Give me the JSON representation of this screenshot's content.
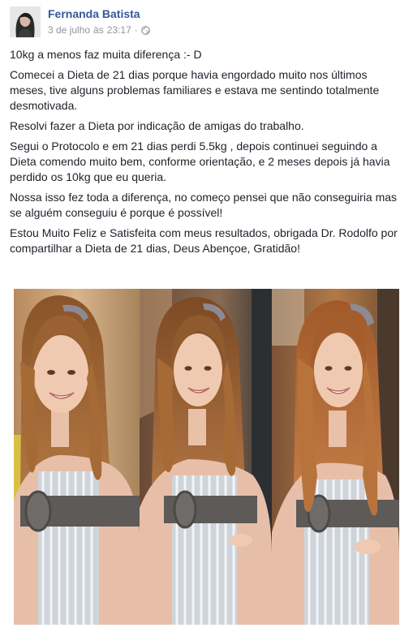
{
  "post": {
    "author": "Fernanda Batista",
    "date": "3 de julho",
    "time_prefix": "às",
    "time": "23:17",
    "separator": "·",
    "privacy_icon": "globe-icon",
    "paragraphs": [
      "10kg a menos faz muita diferença :- D",
      "Comecei a Dieta de 21 dias porque havia engordado muito nos últimos meses, tive alguns problemas familiares e estava me sentindo totalmente desmotivada.",
      "Resolvi fazer a Dieta por indicação de amigas do trabalho.",
      "Segui o Protocolo e em 21 dias perdi 5.5kg , depois continuei seguindo a Dieta comendo muito bem, conforme orientação, e 2 meses depois já havia perdido os 10kg que eu queria.",
      "Nossa isso fez toda a diferença, no começo pensei que não conseguiria mas se alguém conseguiu é porque é possível!",
      "Estou Muito Feliz e Satisfeita com meus resultados, obrigada Dr. Rodolfo por compartilhar a Dieta de 21 dias, Deus Abençoe, Gratidão!"
    ]
  },
  "colors": {
    "author_link": "#365899",
    "meta_text": "#90949c",
    "body_text": "#1d2129"
  }
}
